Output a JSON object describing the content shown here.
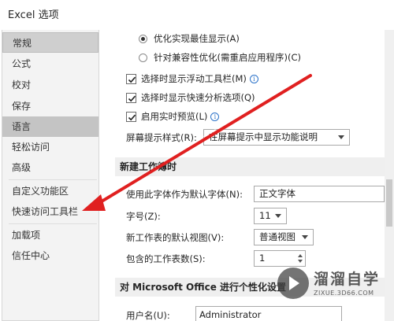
{
  "window": {
    "title": "Excel 选项"
  },
  "sidebar": {
    "items": [
      {
        "label": "常规"
      },
      {
        "label": "公式"
      },
      {
        "label": "校对"
      },
      {
        "label": "保存"
      },
      {
        "label": "语言"
      },
      {
        "label": "轻松访问"
      },
      {
        "label": "高级"
      },
      {
        "label": "自定义功能区"
      },
      {
        "label": "快速访问工具栏"
      },
      {
        "label": "加载项"
      },
      {
        "label": "信任中心"
      }
    ]
  },
  "main": {
    "display_options": {
      "radio_best_appearance": "优化实现最佳显示(A)",
      "radio_compatibility": "针对兼容性优化(需重启应用程序)(C)",
      "checkbox_mini_toolbar": "选择时显示浮动工具栏(M)",
      "checkbox_quick_analysis": "选择时显示快速分析选项(Q)",
      "checkbox_live_preview": "启用实时预览(L)",
      "screentip_label": "屏幕提示样式(R):",
      "screentip_value": "在屏幕提示中显示功能说明"
    },
    "new_workbook": {
      "header": "新建工作簿时",
      "font_label": "使用此字体作为默认字体(N):",
      "font_value": "正文字体",
      "size_label": "字号(Z):",
      "size_value": "11",
      "view_label": "新工作表的默认视图(V):",
      "view_value": "普通视图",
      "sheets_label": "包含的工作表数(S):",
      "sheets_value": "1"
    },
    "personalize": {
      "header": "对 Microsoft Office 进行个性化设置",
      "username_label": "用户名(U):",
      "username_value": "Administrator"
    }
  },
  "watermark": {
    "brand": "溜溜自学",
    "url": "ZIXUE.3D66.COM"
  },
  "colors": {
    "arrow": "#e02020",
    "selected_bg": "#cfcfcf",
    "info_icon": "#2b72c9"
  }
}
